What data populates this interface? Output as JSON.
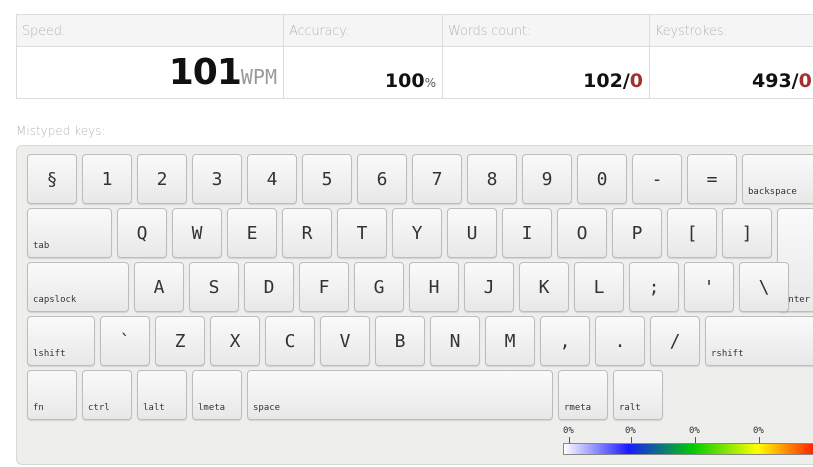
{
  "stats": {
    "speed": {
      "label": "Speed:",
      "value": "101",
      "unit": "WPM"
    },
    "accuracy": {
      "label": "Accuracy:",
      "value": "100",
      "unit": "%"
    },
    "words": {
      "label": "Words count:",
      "value": "102/",
      "errors": "0"
    },
    "keystrokes": {
      "label": "Keystrokes:",
      "value": "493/",
      "errors": "0"
    }
  },
  "mistyped_title": "Mistyped keys:",
  "keyboard": {
    "rows": [
      [
        "§",
        "1",
        "2",
        "3",
        "4",
        "5",
        "6",
        "7",
        "8",
        "9",
        "0",
        "-",
        "=",
        "backspace"
      ],
      [
        "tab",
        "Q",
        "W",
        "E",
        "R",
        "T",
        "Y",
        "U",
        "I",
        "O",
        "P",
        "[",
        "]",
        "enter"
      ],
      [
        "capslock",
        "A",
        "S",
        "D",
        "F",
        "G",
        "H",
        "J",
        "K",
        "L",
        ";",
        "'",
        "\\"
      ],
      [
        "lshift",
        "`",
        "Z",
        "X",
        "C",
        "V",
        "B",
        "N",
        "M",
        ",",
        ".",
        "/",
        "rshift"
      ],
      [
        "fn",
        "ctrl",
        "lalt",
        "lmeta",
        "space",
        "rmeta",
        "ralt"
      ]
    ]
  },
  "legend": {
    "labels": [
      "0%",
      "0%",
      "0%",
      "0%"
    ],
    "colors": [
      "#ffffff",
      "#1a1aff",
      "#00cc00",
      "#ffff00",
      "#ff0000"
    ]
  }
}
